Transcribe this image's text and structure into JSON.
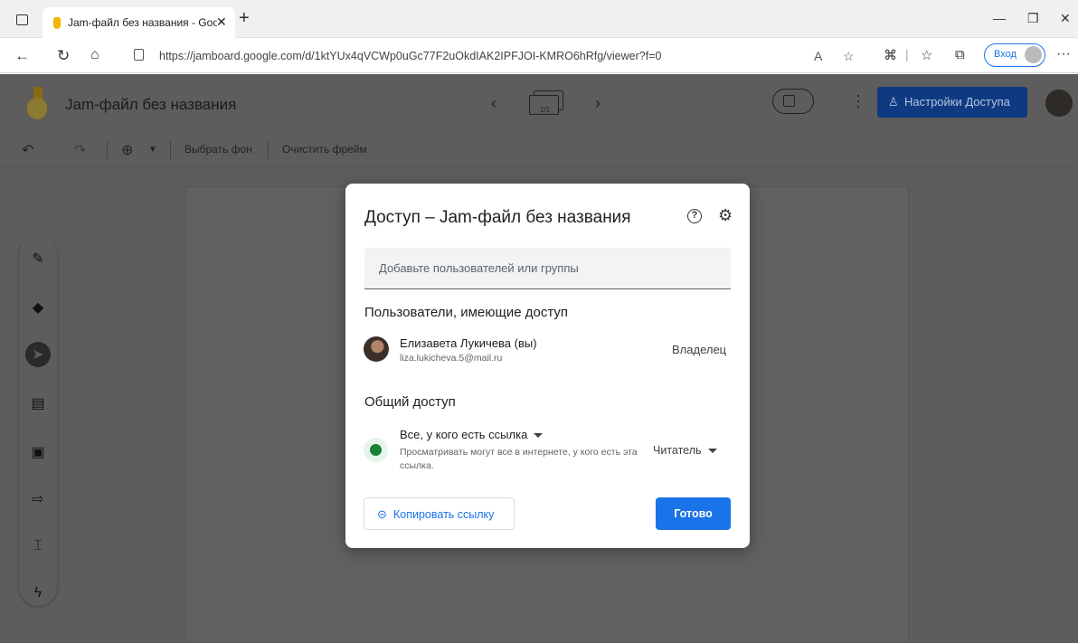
{
  "browser": {
    "tab_title": "Jam-файл без названия - Googl",
    "new_tab": "+",
    "url": "https://jamboard.google.com/d/1ktYUx4qVCWp0uGc77F2uOkdIAK2IPFJOI-KMRO6hRfg/viewer?f=0",
    "login_label": "Вход"
  },
  "app": {
    "doc_title": "Jam-файл без названия",
    "frame_counter": "1/1",
    "share_label": "Настройки Доступа",
    "toolbar": {
      "set_background": "Выбрать фон",
      "clear_frame": "Очистить фрейм"
    }
  },
  "dialog": {
    "title": "Доступ – Jam-файл без названия",
    "add_placeholder": "Добавьте пользователей или группы",
    "users_heading": "Пользователи, имеющие доступ",
    "owner": {
      "name": "Елизавета Лукичева (вы)",
      "email": "liza.lukicheva.5@mail.ru",
      "role": "Владелец"
    },
    "general_heading": "Общий доступ",
    "general": {
      "access": "Все, у кого есть ссылка",
      "description": "Просматривать могут все в интернете, у кого есть эта ссылка.",
      "role": "Читатель"
    },
    "copy_link": "Копировать ссылку",
    "done": "Готово"
  },
  "colors": {
    "primary_blue": "#1a73e8",
    "overlay": "#5d5d5d",
    "globe_green": "#188038"
  },
  "icons": [
    "tab-actions-icon",
    "jamboard-favicon",
    "close-icon",
    "back-icon",
    "reload-icon",
    "home-icon",
    "lock-icon",
    "read-aloud-icon",
    "favorites-add-icon",
    "extensions-icon",
    "favorites-icon",
    "collections-icon",
    "more-icon",
    "undo-icon",
    "redo-icon",
    "zoom-icon",
    "pen-icon",
    "eraser-icon",
    "select-icon",
    "sticky-note-icon",
    "image-icon",
    "shape-icon",
    "text-box-icon",
    "laser-icon",
    "help-icon",
    "settings-icon",
    "globe-icon",
    "link-icon"
  ]
}
